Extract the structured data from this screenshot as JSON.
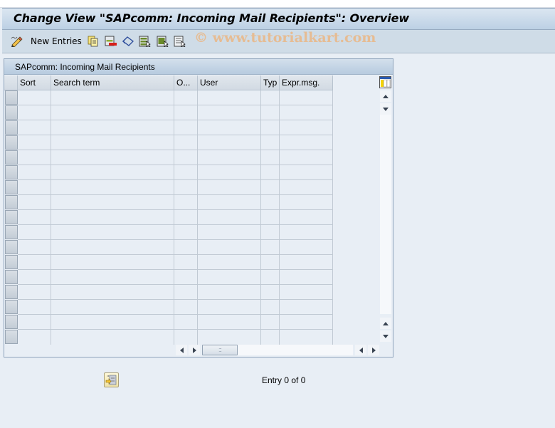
{
  "window": {
    "title": "Change View \"SAPcomm: Incoming Mail Recipients\": Overview"
  },
  "toolbar": {
    "new_entries_label": "New Entries",
    "icons": [
      {
        "name": "edit-pencil-icon"
      },
      {
        "name": "copy-as-icon"
      },
      {
        "name": "delete-icon"
      },
      {
        "name": "undo-change-icon"
      },
      {
        "name": "select-all-icon"
      },
      {
        "name": "select-block-icon"
      },
      {
        "name": "deselect-all-icon"
      }
    ],
    "watermark": "© www.tutorialkart.com"
  },
  "table": {
    "title": "SAPcomm: Incoming Mail Recipients",
    "columns": [
      {
        "key": "sort",
        "label": "Sort"
      },
      {
        "key": "search_term",
        "label": "Search term"
      },
      {
        "key": "object",
        "label": "O..."
      },
      {
        "key": "user",
        "label": "User"
      },
      {
        "key": "type",
        "label": "Typ"
      },
      {
        "key": "expr_msg",
        "label": "Expr.msg."
      }
    ],
    "rows": [],
    "visible_empty_rows": 17,
    "column_config_icon": "table-settings-icon"
  },
  "footer": {
    "position_icon": "position-entry-icon",
    "entry_status": "Entry 0 of 0"
  },
  "colors": {
    "title_bar": "#bcd0e4",
    "toolbar": "#cfdce7",
    "background": "#e8eef5",
    "watermark": "#e9b98a"
  }
}
